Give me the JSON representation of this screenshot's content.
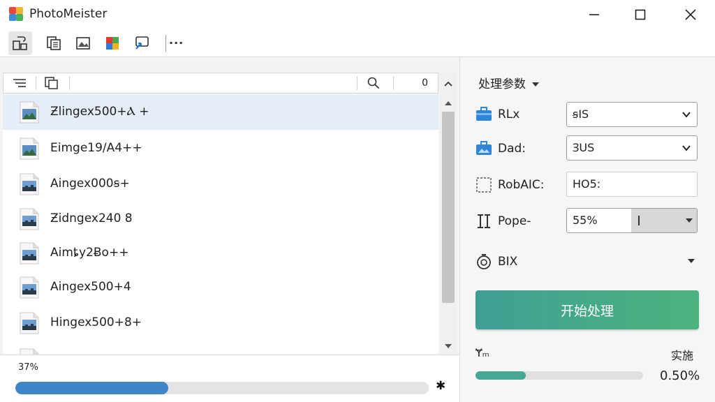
{
  "window": {
    "title": "PhotoMeister",
    "colors": {
      "accent": "#3f86c6",
      "start_button": "#45aa88",
      "selected_row": "#e5eef8"
    }
  },
  "toolbar": {
    "buttons": [
      {
        "icon": "import-icon",
        "active": true
      },
      {
        "icon": "copy-pages-icon",
        "active": false
      },
      {
        "icon": "image-frame-icon",
        "active": false
      },
      {
        "icon": "color-grid-icon",
        "active": false
      },
      {
        "icon": "share-icon",
        "active": false
      }
    ],
    "more_label": "···"
  },
  "list": {
    "count": "0",
    "items": [
      {
        "label": "Ƶlingex500+Ⲁ +",
        "selected": true
      },
      {
        "label": "Eimge19/A4++",
        "selected": false
      },
      {
        "label": "Aingex000ꞩ+",
        "selected": false
      },
      {
        "label": "Ƶidngex240 8",
        "selected": false
      },
      {
        "label": "Aimȶy2Ƀo++",
        "selected": false
      },
      {
        "label": "Aingex500+4",
        "selected": false
      },
      {
        "label": "Hingex500+8+",
        "selected": false
      }
    ]
  },
  "progress": {
    "label": "37%",
    "value": 0.37,
    "cancel_label": "✱"
  },
  "settings": {
    "title": "处理参数",
    "fields": [
      {
        "label": "RLx",
        "value": "ꞩIS"
      },
      {
        "label": "Dad:",
        "value": "ꞫUS"
      },
      {
        "label": "RobAIC:",
        "value": "HO5:"
      },
      {
        "label": "Pope-",
        "value": "55%"
      },
      {
        "label": "BIX"
      }
    ],
    "start_label": "开始处理"
  },
  "status": {
    "left": "Ɏₘ",
    "right": "实施",
    "value": 0.3,
    "percent": "0.50%"
  }
}
